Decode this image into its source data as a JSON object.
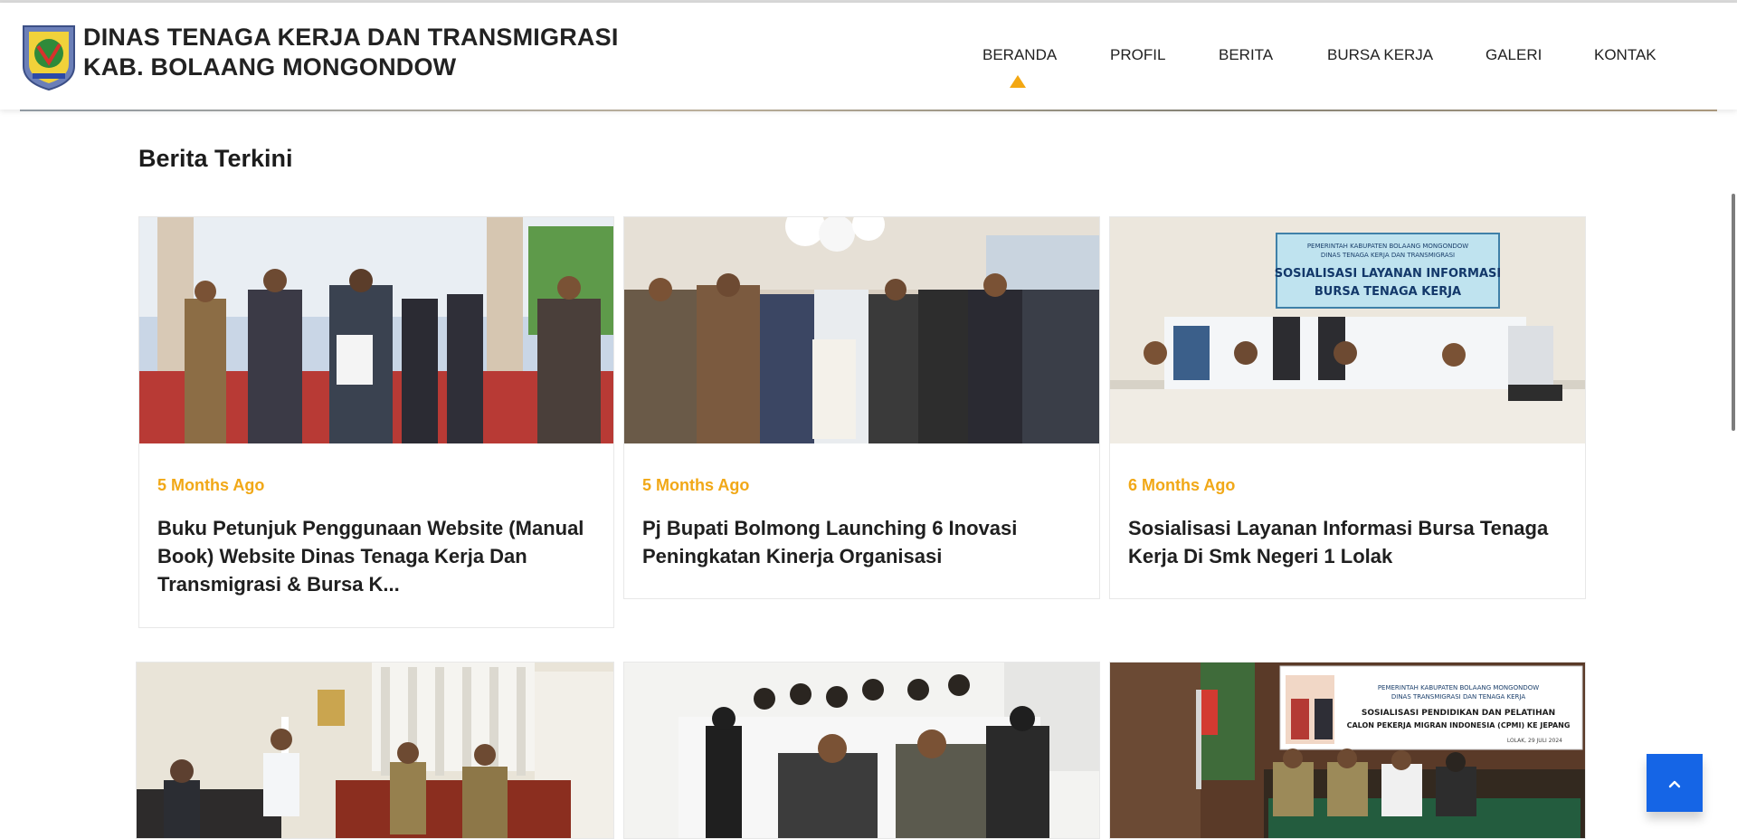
{
  "header": {
    "brand_line1": "DINAS TENAGA KERJA DAN TRANSMIGRASI",
    "brand_line2": "KAB. BOLAANG MONGONDOW",
    "nav": [
      {
        "label": "BERANDA",
        "active": true
      },
      {
        "label": "PROFIL",
        "active": false
      },
      {
        "label": "BERITA",
        "active": false
      },
      {
        "label": "BURSA KERJA",
        "active": false
      },
      {
        "label": "GALERI",
        "active": false
      },
      {
        "label": "KONTAK",
        "active": false
      }
    ],
    "active_color": "#f3a712"
  },
  "section": {
    "title": "Berita Terkini"
  },
  "news": [
    {
      "date": "5 Months Ago",
      "title": "Buku Petunjuk Penggunaan Website (Manual Book) Website Dinas Tenaga Kerja Dan Transmigrasi & Bursa K..."
    },
    {
      "date": "5 Months Ago",
      "title": "Pj Bupati Bolmong Launching 6 Inovasi Peningkatan Kinerja Organisasi"
    },
    {
      "date": "6 Months Ago",
      "title": "Sosialisasi Layanan Informasi Bursa Tenaga Kerja Di Smk Negeri 1 Lolak"
    }
  ],
  "photo_texts": {
    "banner3_line1": "PEMERINTAH KABUPATEN BOLAANG MONGONDOW",
    "banner3_line2": "DINAS TENAGA KERJA DAN TRANSMIGRASI",
    "banner3_line3": "SOSIALISASI LAYANAN INFORMASI",
    "banner3_line4": "BURSA TENAGA KERJA",
    "banner6_line1": "PEMERINTAH KABUPATEN BOLAANG MONGONDOW",
    "banner6_line2": "DINAS TRANSMIGRASI DAN TENAGA KERJA",
    "banner6_line3": "SOSIALISASI PENDIDIKAN DAN PELATIHAN",
    "banner6_line4": "CALON PEKERJA MIGRAN INDONESIA (CPMI) KE JEPANG",
    "banner6_line5": "LOLAK, 29 JULI 2024"
  },
  "colors": {
    "date": "#f1a817",
    "scroll_button": "#1565e6"
  },
  "icons": {
    "scroll_top": "chevron-up-icon",
    "logo": "regency-emblem-icon"
  }
}
